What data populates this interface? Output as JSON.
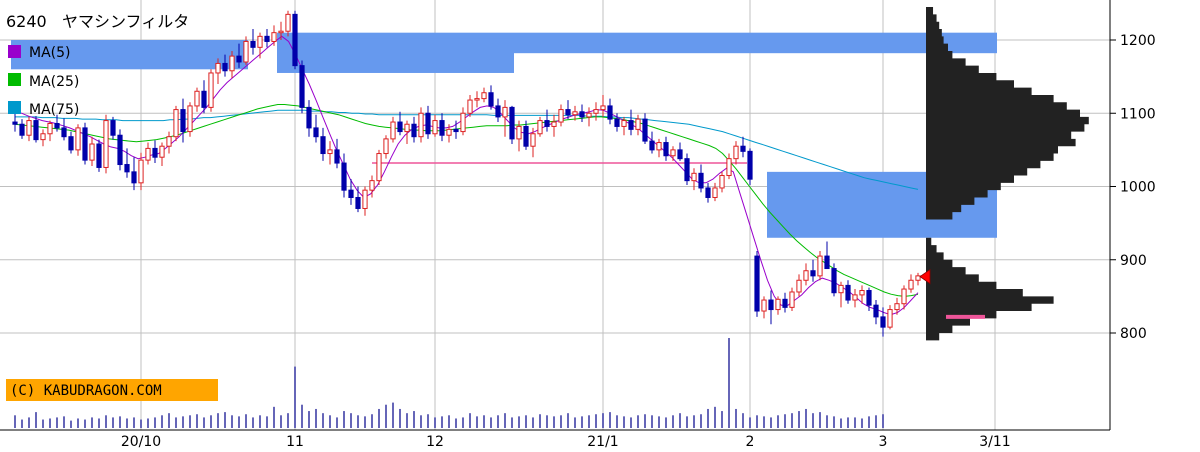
{
  "header": {
    "code": "6240",
    "name": "ヤマシンフィルタ"
  },
  "legend": [
    {
      "label": "MA(5)",
      "color": "#9900cc"
    },
    {
      "label": "MA(25)",
      "color": "#00bb00"
    },
    {
      "label": "MA(75)",
      "color": "#0099cc"
    }
  ],
  "copyright": "(C) KABUDRAGON.COM",
  "colors": {
    "up": "#dd2222",
    "down": "#0000aa",
    "grid": "#c0c0c0",
    "zone": "#6699ee",
    "profile": "#222222",
    "volume": "#000088",
    "ma5": "#9900cc",
    "ma25": "#00bb00",
    "ma75": "#0099cc",
    "support": "#ee5599",
    "marker": "#ff0000"
  },
  "chart_data": {
    "type": "candlestick",
    "y_axis": {
      "ticks": [
        800,
        900,
        1000,
        1100,
        1200
      ],
      "range": [
        730,
        1245
      ],
      "position": "right"
    },
    "x_axis": {
      "ticks": [
        {
          "label": "20/10",
          "index": 18
        },
        {
          "label": "11",
          "index": 40
        },
        {
          "label": "12",
          "index": 60
        },
        {
          "label": "21/1",
          "index": 84
        },
        {
          "label": "2",
          "index": 105
        },
        {
          "label": "3",
          "index": 124
        },
        {
          "label": "3/11",
          "index": 140
        }
      ]
    },
    "candles": [
      [
        1088,
        1100,
        1075,
        1085
      ],
      [
        1085,
        1092,
        1065,
        1070
      ],
      [
        1070,
        1095,
        1062,
        1090
      ],
      [
        1090,
        1096,
        1060,
        1064
      ],
      [
        1064,
        1078,
        1055,
        1072
      ],
      [
        1072,
        1090,
        1062,
        1086
      ],
      [
        1086,
        1098,
        1075,
        1080
      ],
      [
        1080,
        1093,
        1063,
        1068
      ],
      [
        1068,
        1075,
        1045,
        1050
      ],
      [
        1050,
        1085,
        1042,
        1080
      ],
      [
        1080,
        1087,
        1030,
        1036
      ],
      [
        1036,
        1068,
        1028,
        1058
      ],
      [
        1058,
        1064,
        1020,
        1026
      ],
      [
        1026,
        1098,
        1018,
        1090
      ],
      [
        1090,
        1095,
        1064,
        1070
      ],
      [
        1070,
        1078,
        1022,
        1030
      ],
      [
        1030,
        1052,
        1012,
        1020
      ],
      [
        1020,
        1040,
        995,
        1005
      ],
      [
        1005,
        1046,
        995,
        1036
      ],
      [
        1036,
        1060,
        1030,
        1052
      ],
      [
        1052,
        1063,
        1032,
        1040
      ],
      [
        1040,
        1060,
        1028,
        1055
      ],
      [
        1055,
        1075,
        1045,
        1068
      ],
      [
        1068,
        1110,
        1062,
        1105
      ],
      [
        1105,
        1120,
        1060,
        1075
      ],
      [
        1075,
        1115,
        1068,
        1110
      ],
      [
        1110,
        1135,
        1102,
        1130
      ],
      [
        1130,
        1145,
        1100,
        1108
      ],
      [
        1108,
        1160,
        1102,
        1155
      ],
      [
        1155,
        1175,
        1140,
        1168
      ],
      [
        1168,
        1180,
        1150,
        1158
      ],
      [
        1158,
        1185,
        1148,
        1178
      ],
      [
        1178,
        1195,
        1162,
        1170
      ],
      [
        1170,
        1205,
        1166,
        1198
      ],
      [
        1198,
        1215,
        1180,
        1190
      ],
      [
        1190,
        1210,
        1175,
        1205
      ],
      [
        1205,
        1215,
        1190,
        1198
      ],
      [
        1198,
        1220,
        1192,
        1210
      ],
      [
        1210,
        1225,
        1200,
        1212
      ],
      [
        1212,
        1240,
        1205,
        1235
      ],
      [
        1235,
        1240,
        1160,
        1165
      ],
      [
        1165,
        1172,
        1100,
        1108
      ],
      [
        1108,
        1118,
        1068,
        1080
      ],
      [
        1080,
        1098,
        1060,
        1068
      ],
      [
        1068,
        1080,
        1035,
        1045
      ],
      [
        1045,
        1062,
        1030,
        1050
      ],
      [
        1050,
        1065,
        1025,
        1032
      ],
      [
        1032,
        1045,
        985,
        995
      ],
      [
        995,
        1010,
        975,
        985
      ],
      [
        985,
        1000,
        965,
        970
      ],
      [
        970,
        1000,
        960,
        995
      ],
      [
        995,
        1015,
        985,
        1008
      ],
      [
        1008,
        1050,
        1002,
        1045
      ],
      [
        1045,
        1070,
        1038,
        1065
      ],
      [
        1065,
        1095,
        1060,
        1088
      ],
      [
        1088,
        1102,
        1070,
        1075
      ],
      [
        1075,
        1090,
        1058,
        1085
      ],
      [
        1085,
        1095,
        1060,
        1068
      ],
      [
        1068,
        1108,
        1060,
        1100
      ],
      [
        1100,
        1110,
        1065,
        1072
      ],
      [
        1072,
        1098,
        1068,
        1090
      ],
      [
        1090,
        1100,
        1062,
        1070
      ],
      [
        1070,
        1085,
        1060,
        1078
      ],
      [
        1078,
        1090,
        1065,
        1075
      ],
      [
        1075,
        1108,
        1070,
        1100
      ],
      [
        1100,
        1125,
        1095,
        1118
      ],
      [
        1118,
        1130,
        1108,
        1120
      ],
      [
        1120,
        1135,
        1115,
        1128
      ],
      [
        1128,
        1138,
        1105,
        1110
      ],
      [
        1110,
        1120,
        1088,
        1095
      ],
      [
        1095,
        1118,
        1068,
        1108
      ],
      [
        1108,
        1110,
        1058,
        1065
      ],
      [
        1065,
        1090,
        1048,
        1082
      ],
      [
        1082,
        1090,
        1050,
        1055
      ],
      [
        1055,
        1080,
        1040,
        1072
      ],
      [
        1072,
        1095,
        1068,
        1090
      ],
      [
        1090,
        1105,
        1075,
        1082
      ],
      [
        1082,
        1098,
        1068,
        1088
      ],
      [
        1088,
        1112,
        1082,
        1105
      ],
      [
        1105,
        1118,
        1092,
        1098
      ],
      [
        1098,
        1110,
        1090,
        1102
      ],
      [
        1102,
        1112,
        1088,
        1095
      ],
      [
        1095,
        1108,
        1082,
        1100
      ],
      [
        1100,
        1115,
        1090,
        1105
      ],
      [
        1105,
        1125,
        1095,
        1110
      ],
      [
        1110,
        1120,
        1085,
        1092
      ],
      [
        1092,
        1100,
        1075,
        1082
      ],
      [
        1082,
        1095,
        1070,
        1090
      ],
      [
        1090,
        1105,
        1070,
        1078
      ],
      [
        1078,
        1098,
        1070,
        1092
      ],
      [
        1092,
        1100,
        1058,
        1062
      ],
      [
        1062,
        1075,
        1045,
        1050
      ],
      [
        1050,
        1065,
        1040,
        1060
      ],
      [
        1060,
        1068,
        1035,
        1042
      ],
      [
        1042,
        1055,
        1035,
        1050
      ],
      [
        1050,
        1060,
        1035,
        1038
      ],
      [
        1038,
        1045,
        1002,
        1008
      ],
      [
        1008,
        1025,
        995,
        1018
      ],
      [
        1018,
        1030,
        992,
        998
      ],
      [
        998,
        1005,
        978,
        985
      ],
      [
        985,
        1005,
        980,
        998
      ],
      [
        998,
        1020,
        992,
        1015
      ],
      [
        1015,
        1045,
        1010,
        1038
      ],
      [
        1038,
        1062,
        1030,
        1055
      ],
      [
        1055,
        1068,
        1040,
        1048
      ],
      [
        1048,
        1052,
        1002,
        1010
      ],
      [
        905,
        912,
        822,
        830
      ],
      [
        830,
        850,
        820,
        845
      ],
      [
        845,
        858,
        812,
        832
      ],
      [
        832,
        850,
        825,
        846
      ],
      [
        846,
        855,
        828,
        835
      ],
      [
        835,
        862,
        830,
        856
      ],
      [
        856,
        880,
        850,
        872
      ],
      [
        872,
        895,
        865,
        885
      ],
      [
        885,
        900,
        870,
        878
      ],
      [
        878,
        912,
        872,
        905
      ],
      [
        905,
        925,
        895,
        888
      ],
      [
        888,
        895,
        850,
        855
      ],
      [
        855,
        870,
        835,
        865
      ],
      [
        865,
        872,
        840,
        845
      ],
      [
        845,
        860,
        835,
        852
      ],
      [
        852,
        865,
        840,
        858
      ],
      [
        858,
        862,
        830,
        838
      ],
      [
        838,
        845,
        812,
        822
      ],
      [
        822,
        835,
        795,
        808
      ],
      [
        808,
        838,
        805,
        832
      ],
      [
        832,
        848,
        825,
        840
      ],
      [
        840,
        865,
        832,
        860
      ],
      [
        860,
        880,
        855,
        872
      ],
      [
        872,
        882,
        865,
        878
      ]
    ],
    "volume": [
      12,
      8,
      10,
      15,
      8,
      9,
      10,
      11,
      7,
      9,
      8,
      10,
      9,
      12,
      10,
      11,
      9,
      10,
      8,
      9,
      10,
      12,
      14,
      10,
      11,
      12,
      13,
      10,
      12,
      14,
      15,
      12,
      11,
      13,
      10,
      12,
      11,
      20,
      12,
      14,
      58,
      22,
      16,
      18,
      14,
      12,
      10,
      16,
      14,
      12,
      11,
      13,
      18,
      22,
      24,
      18,
      14,
      16,
      12,
      13,
      10,
      11,
      12,
      9,
      10,
      14,
      11,
      12,
      10,
      12,
      14,
      10,
      11,
      12,
      10,
      13,
      12,
      11,
      12,
      14,
      10,
      11,
      12,
      13,
      14,
      15,
      12,
      11,
      10,
      12,
      13,
      12,
      11,
      10,
      12,
      14,
      11,
      12,
      13,
      18,
      20,
      16,
      85,
      18,
      14,
      10,
      12,
      11,
      10,
      12,
      13,
      14,
      16,
      18,
      14,
      15,
      12,
      11,
      9,
      10,
      10,
      9,
      11,
      12,
      13
    ],
    "ma5": [
      1103,
      1100,
      1096,
      1093,
      1090,
      1088,
      1086,
      1083,
      1080,
      1076,
      1072,
      1068,
      1063,
      1058,
      1054,
      1052,
      1048,
      1042,
      1038,
      1040,
      1043,
      1045,
      1052,
      1060,
      1068,
      1078,
      1088,
      1098,
      1108,
      1120,
      1132,
      1142,
      1150,
      1158,
      1166,
      1174,
      1182,
      1190,
      1198,
      1205,
      1198,
      1180,
      1160,
      1140,
      1118,
      1095,
      1072,
      1050,
      1030,
      1010,
      995,
      985,
      990,
      1002,
      1020,
      1040,
      1058,
      1070,
      1078,
      1082,
      1084,
      1082,
      1080,
      1080,
      1082,
      1088,
      1095,
      1102,
      1108,
      1110,
      1108,
      1100,
      1090,
      1080,
      1074,
      1072,
      1075,
      1080,
      1084,
      1088,
      1092,
      1095,
      1098,
      1100,
      1102,
      1105,
      1104,
      1100,
      1095,
      1090,
      1085,
      1080,
      1072,
      1064,
      1056,
      1048,
      1040,
      1030,
      1020,
      1010,
      1005,
      1005,
      1010,
      1018,
      1025,
      1020,
      990,
      960,
      930,
      900,
      872,
      850,
      838,
      838,
      845,
      852,
      862,
      870,
      875,
      872,
      868,
      862,
      856,
      848,
      840,
      835,
      832,
      828,
      825,
      828,
      835,
      845,
      855
    ],
    "ma25": [
      1085,
      1084,
      1083,
      1082,
      1081,
      1080,
      1079,
      1078,
      1077,
      1075,
      1073,
      1071,
      1069,
      1067,
      1065,
      1064,
      1063,
      1062,
      1061,
      1062,
      1063,
      1064,
      1066,
      1068,
      1070,
      1073,
      1076,
      1079,
      1082,
      1085,
      1088,
      1091,
      1094,
      1097,
      1100,
      1103,
      1106,
      1108,
      1110,
      1112,
      1112,
      1111,
      1110,
      1108,
      1106,
      1104,
      1102,
      1100,
      1098,
      1095,
      1092,
      1089,
      1086,
      1084,
      1082,
      1081,
      1080,
      1079,
      1078,
      1077,
      1077,
      1076,
      1076,
      1076,
      1077,
      1078,
      1079,
      1080,
      1081,
      1082,
      1083,
      1083,
      1083,
      1083,
      1084,
      1084,
      1085,
      1086,
      1087,
      1088,
      1089,
      1090,
      1091,
      1092,
      1093,
      1094,
      1095,
      1095,
      1094,
      1093,
      1092,
      1090,
      1088,
      1086,
      1083,
      1080,
      1077,
      1074,
      1071,
      1068,
      1065,
      1062,
      1059,
      1056,
      1052,
      1045,
      1035,
      1024,
      1012,
      1000,
      988,
      976,
      965,
      955,
      945,
      935,
      926,
      918,
      910,
      903,
      897,
      891,
      885,
      880,
      876,
      872,
      868,
      864,
      860,
      856,
      853,
      851,
      850,
      851,
      853
    ],
    "ma75": [
      1095,
      1095,
      1095,
      1095,
      1094,
      1094,
      1094,
      1093,
      1093,
      1093,
      1092,
      1092,
      1092,
      1091,
      1091,
      1091,
      1090,
      1090,
      1090,
      1090,
      1090,
      1090,
      1090,
      1091,
      1091,
      1092,
      1092,
      1093,
      1094,
      1094,
      1095,
      1096,
      1097,
      1098,
      1099,
      1100,
      1101,
      1102,
      1103,
      1104,
      1104,
      1104,
      1104,
      1104,
      1103,
      1103,
      1102,
      1102,
      1101,
      1101,
      1100,
      1100,
      1099,
      1099,
      1098,
      1098,
      1098,
      1098,
      1098,
      1098,
      1098,
      1098,
      1098,
      1098,
      1098,
      1098,
      1098,
      1098,
      1098,
      1098,
      1098,
      1097,
      1097,
      1097,
      1097,
      1097,
      1097,
      1097,
      1097,
      1097,
      1097,
      1097,
      1097,
      1097,
      1097,
      1096,
      1096,
      1096,
      1095,
      1095,
      1094,
      1094,
      1093,
      1092,
      1091,
      1090,
      1089,
      1088,
      1087,
      1086,
      1085,
      1083,
      1081,
      1079,
      1077,
      1075,
      1072,
      1069,
      1066,
      1063,
      1060,
      1057,
      1054,
      1051,
      1048,
      1045,
      1042,
      1039,
      1036,
      1033,
      1030,
      1027,
      1024,
      1021,
      1018,
      1015,
      1012,
      1010,
      1008,
      1006,
      1004,
      1002,
      1000,
      998,
      996
    ],
    "supply_zones": [
      {
        "price_from": 1182,
        "price_to": 1210,
        "index_from": 38,
        "index_to": 140
      },
      {
        "price_from": 1155,
        "price_to": 1202,
        "index_from": 38,
        "index_to": 71
      },
      {
        "price_from": 1160,
        "price_to": 1200,
        "index_from": 0,
        "index_to": 33
      },
      {
        "price_from": 930,
        "price_to": 1020,
        "index_from": 108,
        "index_to": 140
      }
    ],
    "support_lines": [
      {
        "price": 1032,
        "index_from": 51,
        "index_to": 104
      },
      {
        "price": 822,
        "index_from": 133,
        "index_to": 138
      }
    ],
    "profile_upper": [
      [
        960,
        30
      ],
      [
        970,
        40
      ],
      [
        980,
        55
      ],
      [
        990,
        70
      ],
      [
        1000,
        85
      ],
      [
        1010,
        100
      ],
      [
        1020,
        115
      ],
      [
        1030,
        130
      ],
      [
        1040,
        145
      ],
      [
        1050,
        150
      ],
      [
        1060,
        170
      ],
      [
        1070,
        165
      ],
      [
        1080,
        180
      ],
      [
        1090,
        185
      ],
      [
        1100,
        175
      ],
      [
        1110,
        160
      ],
      [
        1120,
        145
      ],
      [
        1130,
        120
      ],
      [
        1140,
        100
      ],
      [
        1150,
        80
      ],
      [
        1160,
        60
      ],
      [
        1170,
        45
      ],
      [
        1180,
        30
      ],
      [
        1190,
        25
      ],
      [
        1200,
        20
      ],
      [
        1210,
        18
      ],
      [
        1220,
        15
      ],
      [
        1230,
        12
      ],
      [
        1240,
        8
      ]
    ],
    "profile_lower": [
      [
        795,
        15
      ],
      [
        805,
        30
      ],
      [
        815,
        50
      ],
      [
        825,
        80
      ],
      [
        835,
        120
      ],
      [
        845,
        145
      ],
      [
        855,
        110
      ],
      [
        865,
        80
      ],
      [
        875,
        60
      ],
      [
        885,
        45
      ],
      [
        895,
        30
      ],
      [
        905,
        20
      ],
      [
        915,
        12
      ],
      [
        925,
        6
      ]
    ],
    "last_price_marker": 877
  }
}
